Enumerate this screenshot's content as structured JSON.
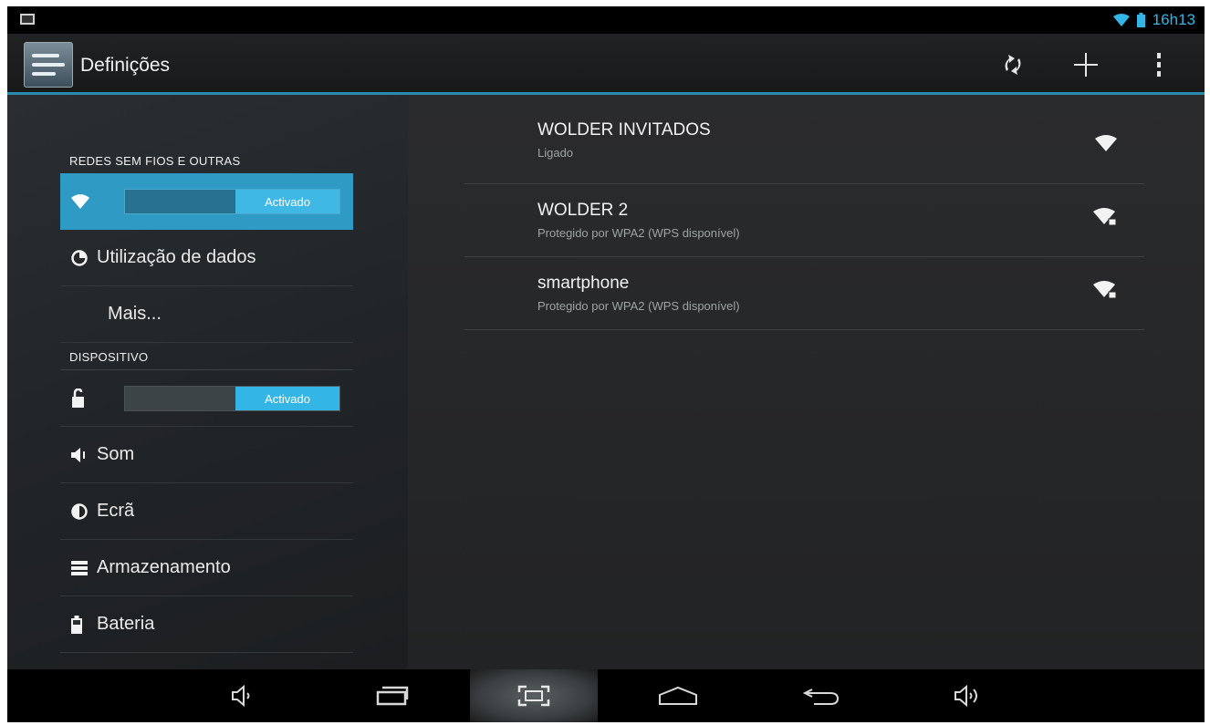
{
  "status_bar": {
    "time": "16h13",
    "accent_color": "#33b5e5",
    "icons": [
      "screenshot-icon",
      "wifi-icon",
      "battery-icon"
    ]
  },
  "action_bar": {
    "title": "Definições",
    "icons": [
      "settings-app-icon",
      "sync-icon",
      "add-icon",
      "overflow-menu-icon"
    ]
  },
  "sidebar": {
    "sections": [
      {
        "header": "REDES SEM FIOS E OUTRAS",
        "items": [
          {
            "icon": "wifi-icon",
            "switch_label": "Activado",
            "selected": true
          },
          {
            "icon": "data-usage-icon",
            "label": "Utilização de dados"
          },
          {
            "label": "Mais..."
          }
        ]
      },
      {
        "header": "DISPOSITIVO",
        "items": [
          {
            "icon": "bluetooth-lock-icon",
            "switch_label": "Activado"
          },
          {
            "icon": "sound-icon",
            "label": "Som"
          },
          {
            "icon": "display-icon",
            "label": "Ecrã"
          },
          {
            "icon": "storage-icon",
            "label": "Armazenamento"
          },
          {
            "icon": "battery-icon",
            "label": "Bateria"
          }
        ]
      }
    ]
  },
  "networks": [
    {
      "name": "WOLDER INVITADOS",
      "status": "Ligado",
      "icon": "wifi-signal-icon"
    },
    {
      "name": "WOLDER 2",
      "status": "Protegido por WPA2 (WPS disponível)",
      "icon": "wifi-secured-icon"
    },
    {
      "name": "smartphone",
      "status": "Protegido por WPA2 (WPS disponível)",
      "icon": "wifi-secured-icon"
    }
  ],
  "nav_bar": {
    "buttons": [
      "volume-down-icon",
      "recent-apps-icon",
      "screenshot-icon",
      "home-icon",
      "back-icon",
      "volume-up-icon"
    ]
  }
}
